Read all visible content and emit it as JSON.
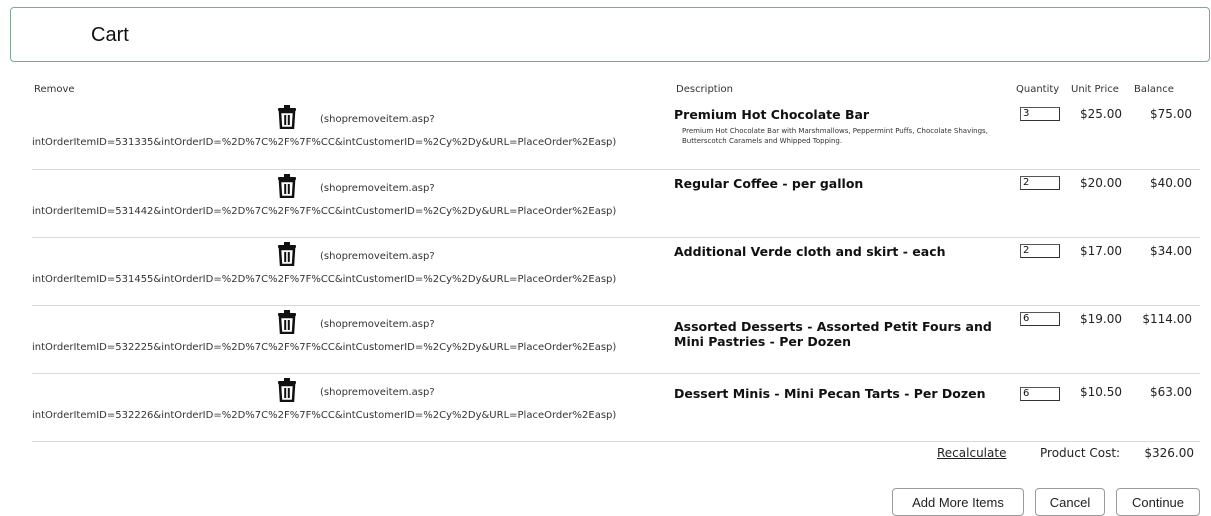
{
  "header": {
    "title": "Cart"
  },
  "columns": {
    "remove": "Remove",
    "description": "Description",
    "quantity": "Quantity",
    "unit_price": "Unit Price",
    "balance": "Balance"
  },
  "items": [
    {
      "remove_url_line1": "(shopremoveitem.asp?",
      "remove_url_line2": "intOrderItemID=531335&intOrderID=%2D%7C%2F%7F%CC&intCustomerID=%2Cy%2Dy&URL=PlaceOrder%2Easp)",
      "title": "Premium Hot Chocolate Bar",
      "subtitle": "Premium Hot Chocolate Bar with Marshmallows, Peppermint Puffs, Chocolate Shavings, Butterscotch Caramels and Whipped Topping.",
      "quantity": "3",
      "unit_price": "$25.00",
      "balance": "$75.00"
    },
    {
      "remove_url_line1": "(shopremoveitem.asp?",
      "remove_url_line2": "intOrderItemID=531442&intOrderID=%2D%7C%2F%7F%CC&intCustomerID=%2Cy%2Dy&URL=PlaceOrder%2Easp)",
      "title": "Regular Coffee - per gallon",
      "subtitle": "",
      "quantity": "2",
      "unit_price": "$20.00",
      "balance": "$40.00"
    },
    {
      "remove_url_line1": "(shopremoveitem.asp?",
      "remove_url_line2": "intOrderItemID=531455&intOrderID=%2D%7C%2F%7F%CC&intCustomerID=%2Cy%2Dy&URL=PlaceOrder%2Easp)",
      "title": "Additional Verde cloth and skirt - each",
      "subtitle": "",
      "quantity": "2",
      "unit_price": "$17.00",
      "balance": "$34.00"
    },
    {
      "remove_url_line1": "(shopremoveitem.asp?",
      "remove_url_line2": "intOrderItemID=532225&intOrderID=%2D%7C%2F%7F%CC&intCustomerID=%2Cy%2Dy&URL=PlaceOrder%2Easp)",
      "title": "Assorted Desserts - Assorted Petit Fours and Mini Pastries - Per Dozen",
      "subtitle": "",
      "quantity": "6",
      "unit_price": "$19.00",
      "balance": "$114.00"
    },
    {
      "remove_url_line1": "(shopremoveitem.asp?",
      "remove_url_line2": "intOrderItemID=532226&intOrderID=%2D%7C%2F%7F%CC&intCustomerID=%2Cy%2Dy&URL=PlaceOrder%2Easp)",
      "title": "Dessert Minis - Mini Pecan Tarts - Per Dozen",
      "subtitle": "",
      "quantity": "6",
      "unit_price": "$10.50",
      "balance": "$63.00"
    }
  ],
  "footer": {
    "recalculate": "Recalculate",
    "product_cost_label": "Product Cost:",
    "product_cost_value": "$326.00"
  },
  "buttons": {
    "add_more": "Add More Items",
    "cancel": "Cancel",
    "continue": "Continue"
  },
  "icons": {
    "remove": "trash-icon"
  }
}
